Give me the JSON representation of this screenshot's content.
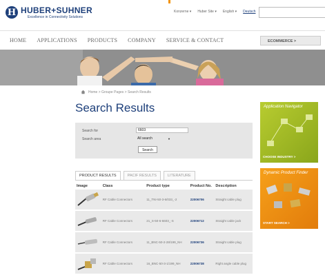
{
  "brand": {
    "name": "HUBER+SUHNER",
    "tagline": "Excellence in Connectivity Solutions",
    "logo_mark": "H"
  },
  "utility": {
    "items": [
      "Konzerne",
      "Huber Site",
      "English"
    ],
    "highlight": "Deutsch"
  },
  "search": {
    "placeholder": ""
  },
  "nav": {
    "items": [
      "HOME",
      "APPLICATIONS",
      "PRODUCTS",
      "COMPANY",
      "SERVICE & CONTACT"
    ],
    "ecommerce": "ECOMMERCE >"
  },
  "breadcrumb": "Home > Groupe Pages > Search Results",
  "page": {
    "title": "Search Results"
  },
  "search_form": {
    "search_for_label": "Search for",
    "search_for_value": "6603",
    "search_area_label": "Search area",
    "search_area_value": "All search",
    "button": "Search"
  },
  "tabs": [
    "PRODUCT RESULTS",
    "PACIF RESULTS",
    "LITERATURE"
  ],
  "table": {
    "headers": [
      "Image",
      "Class",
      "Product type",
      "Product No.",
      "Description"
    ],
    "rows": [
      {
        "class": "RF Cable Connectors",
        "type": "11_TNI-50-3-6/033_-2",
        "product_no": "22006706",
        "desc": "Straight cable plug"
      },
      {
        "class": "RF Cable Connectors",
        "type": "21_S-50-6-6603_-S",
        "product_no": "22006712",
        "desc": "Straight cable jack"
      },
      {
        "class": "RF Cable Connectors",
        "type": "11_BNC-50-2-28/199_NH",
        "product_no": "22006736",
        "desc": "Straight cable plug"
      },
      {
        "class": "RF Cable Connectors",
        "type": "16_BNC-50-3-1/199_NH",
        "product_no": "22006738",
        "desc": "Right angle cable plug"
      }
    ]
  },
  "sidebar": {
    "promo1": {
      "title": "Application Navigator",
      "link": "CHOOSE INDUSTRY >"
    },
    "promo2": {
      "title": "Dynamic Product Finder",
      "link": "START SEARCH >"
    }
  },
  "colors": {
    "brand_blue": "#1d3f7a",
    "accent_orange": "#f39200",
    "promo_green": "#9eb624"
  }
}
